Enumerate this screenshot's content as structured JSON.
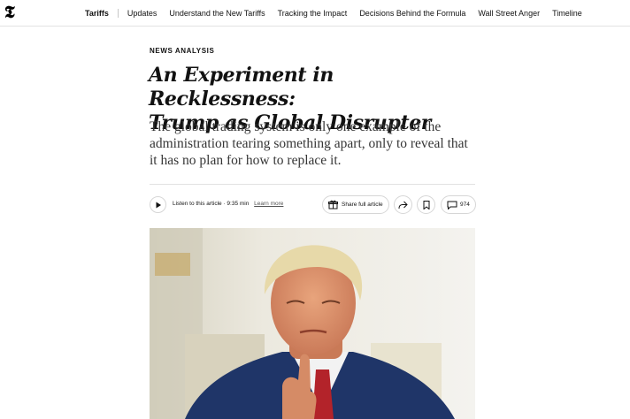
{
  "logo": {
    "glyph": "𝕿"
  },
  "nav": {
    "items": [
      {
        "label": "Tariffs",
        "active": true
      },
      {
        "label": "Updates"
      },
      {
        "label": "Understand the New Tariffs"
      },
      {
        "label": "Tracking the Impact"
      },
      {
        "label": "Decisions Behind the Formula"
      },
      {
        "label": "Wall Street Anger"
      },
      {
        "label": "Timeline"
      }
    ]
  },
  "article": {
    "kicker": "NEWS ANALYSIS",
    "headline_line1": "An Experiment in Recklessness:",
    "headline_line2": "Trump as Global Disrupter",
    "summary": "The global trading system is only one example of the administration tearing something apart, only to reveal that it has no plan for how to replace it."
  },
  "toolbar": {
    "listen_label": "Listen to this article · 9:35 min",
    "learn_more": "Learn more",
    "share_label": "Share full article",
    "comments_count": "974"
  },
  "colors": {
    "text": "#121212",
    "border": "#e2e2e2",
    "suit": "#1f3568",
    "tie": "#b3232a"
  }
}
